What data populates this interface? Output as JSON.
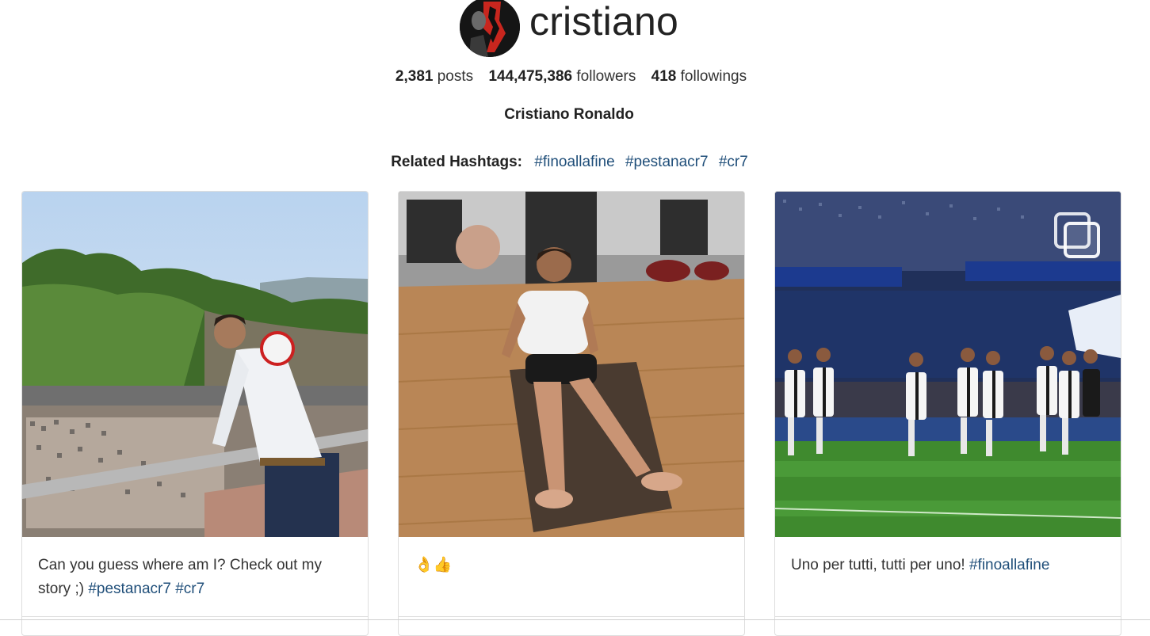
{
  "profile": {
    "username": "cristiano",
    "full_name": "Cristiano Ronaldo",
    "stats": {
      "posts_count": "2,381",
      "posts_label": "posts",
      "followers_count": "144,475,386",
      "followers_label": "followers",
      "followings_count": "418",
      "followings_label": "followings"
    }
  },
  "related_hashtags": {
    "label": "Related Hashtags:",
    "tags": [
      "#finoallafine",
      "#pestanacr7",
      "#cr7"
    ]
  },
  "posts": [
    {
      "caption_text": "Can you guess where am I? Check out my story ;)",
      "caption_tags": [
        "#pestanacr7",
        "#cr7"
      ]
    },
    {
      "caption_text": "👌👍",
      "caption_tags": []
    },
    {
      "caption_text": "Uno per tutti, tutti per uno!",
      "caption_tags": [
        "#finoallafine"
      ],
      "icon": "multiple-images-icon"
    }
  ],
  "colors": {
    "link": "#1f4e79",
    "text": "#212529",
    "border": "#dedede"
  }
}
